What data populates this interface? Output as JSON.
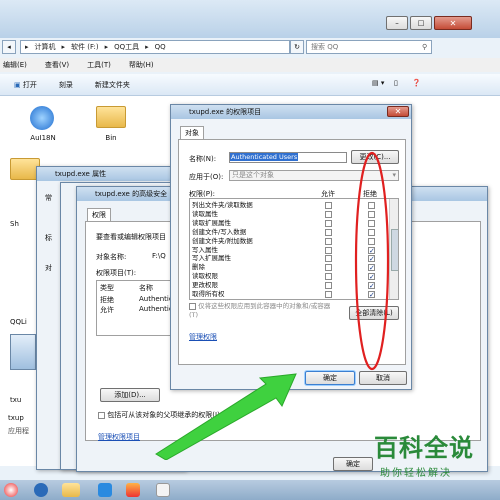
{
  "explorer": {
    "address_segments": [
      "计算机",
      "软件 (F:)",
      "QQ工具",
      "QQ"
    ],
    "search_placeholder": "搜索 QQ",
    "menu": [
      "编辑(E)",
      "查看(V)",
      "工具(T)",
      "帮助(H)"
    ],
    "toolbar": [
      "打开",
      "刻录",
      "新建文件夹"
    ],
    "items": [
      {
        "label": "AuI18N"
      },
      {
        "label": "Bin"
      },
      {
        "label": "Sh"
      },
      {
        "label": "QQLi"
      },
      {
        "label": "txu"
      },
      {
        "label": "txup"
      },
      {
        "label": "应用程"
      }
    ],
    "left_fragments": [
      "常",
      "标",
      "对"
    ]
  },
  "props_dialog": {
    "title": "txupd.exe 属性"
  },
  "advanced_dialog": {
    "title": "txupd.exe 的高级安全",
    "tabs": [
      "权限"
    ],
    "description": "要查看或编辑权限项目",
    "object_name_label": "对象名称:",
    "object_name_value": "F:\\Q",
    "entries_label": "权限项目(T):",
    "columns": [
      "类型",
      "名称"
    ],
    "rows": [
      [
        "拒绝",
        "Authentic"
      ],
      [
        "允许",
        "Authentic"
      ]
    ],
    "add_button": "添加(D)...",
    "inherit_label": "包括可从该对象的父项继承的权限(I)",
    "manage_link": "管理权限项目"
  },
  "perm_dialog": {
    "title": "txupd.exe 的权限项目",
    "tab": "对象",
    "name_label": "名称(N):",
    "name_value": "Authenticated Users",
    "change_button": "更改(C)...",
    "apply_label": "应用于(O):",
    "apply_value": "只是这个对象",
    "perm_header": "权限(P):",
    "allow_header": "允许",
    "deny_header": "拒绝",
    "permissions": [
      {
        "name": "列出文件夹/读取数据",
        "allow": false,
        "deny": false
      },
      {
        "name": "读取属性",
        "allow": false,
        "deny": false
      },
      {
        "name": "读取扩展属性",
        "allow": false,
        "deny": false
      },
      {
        "name": "创建文件/写入数据",
        "allow": false,
        "deny": false
      },
      {
        "name": "创建文件夹/附加数据",
        "allow": false,
        "deny": false
      },
      {
        "name": "写入属性",
        "allow": false,
        "deny": true
      },
      {
        "name": "写入扩展属性",
        "allow": false,
        "deny": true
      },
      {
        "name": "删除",
        "allow": false,
        "deny": true
      },
      {
        "name": "读取权限",
        "allow": false,
        "deny": true
      },
      {
        "name": "更改权限",
        "allow": false,
        "deny": true
      },
      {
        "name": "取得所有权",
        "allow": false,
        "deny": true
      }
    ],
    "apply_children_label": "仅将这些权限应用到此容器中的对象和/或容器(T)",
    "clear_all_button": "全部清除(L)",
    "manage_link": "管理权限",
    "ok_button": "确定",
    "cancel_button": "取消"
  },
  "bottom_ok": "确定",
  "watermark": {
    "title": "百科全说",
    "subtitle": "助你轻松解决"
  },
  "colors": {
    "annotation": "#e02020",
    "arrow": "#3fd13f",
    "link": "#1a4fb5"
  }
}
